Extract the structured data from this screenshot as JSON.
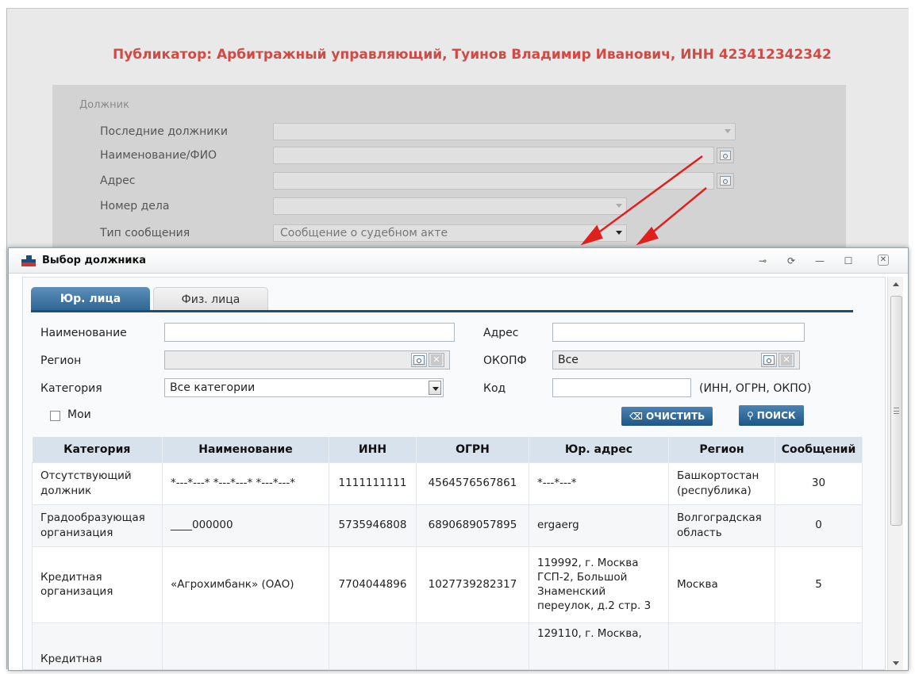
{
  "publisher": "Публикатор: Арбитражный управляющий, Туинов Владимир Иванович, ИНН 423412342342",
  "debtor_form": {
    "legend": "Должник",
    "fields": [
      {
        "label": "Последние должники",
        "value": ""
      },
      {
        "label": "Наименование/ФИО",
        "value": ""
      },
      {
        "label": "Адрес",
        "value": ""
      },
      {
        "label": "Номер дела",
        "value": ""
      },
      {
        "label": "Тип сообщения",
        "value": "Сообщение о судебном акте"
      }
    ]
  },
  "dialog": {
    "title": "Выбор должника",
    "tabs": [
      {
        "label": "Юр. лица",
        "active": true
      },
      {
        "label": "Физ. лица",
        "active": false
      }
    ],
    "filters": {
      "name_label": "Наименование",
      "name_value": "",
      "region_label": "Регион",
      "region_value": "",
      "category_label": "Категория",
      "category_value": "Все категории",
      "mine_label": "Мои",
      "address_label": "Адрес",
      "address_value": "",
      "okopf_label": "ОКОПФ",
      "okopf_value": "Все",
      "code_label": "Код",
      "code_value": "",
      "code_hint": "(ИНН, ОГРН, ОКПО)",
      "clear_label": "ОЧИСТИТЬ",
      "search_label": "ПОИСК"
    },
    "table": {
      "columns": [
        "Категория",
        "Наименование",
        "ИНН",
        "ОГРН",
        "Юр. адрес",
        "Регион",
        "Сообщений"
      ],
      "rows": [
        {
          "category": "Отсутствующий должник",
          "name": "*---*---* *---*---* *---*---*",
          "inn": "1111111111",
          "ogrn": "4564576567861",
          "address": "*---*---*",
          "region": "Башкортостан (республика)",
          "messages": "30"
        },
        {
          "category": "Градообразующая организация",
          "name": "____000000",
          "inn": "5735946808",
          "ogrn": "6890689057895",
          "address": "ergaerg",
          "region": "Волгоградская область",
          "messages": "0"
        },
        {
          "category": "Кредитная организация",
          "name": "«Агрохимбанк» (ОАО)",
          "inn": "7704044896",
          "ogrn": "1027739282317",
          "address": "119992, г. Москва ГСП-2, Большой Знаменский переулок, д.2 стр. 3",
          "region": "Москва",
          "messages": "5"
        },
        {
          "category": "Кредитная",
          "name": "",
          "inn": "",
          "ogrn": "",
          "address": "129110, г. Москва,",
          "region": "",
          "messages": ""
        }
      ]
    }
  },
  "colors": {
    "publisher_red": "#d24a44",
    "tab_active": "#2e6593",
    "button_blue": "#1e5686",
    "arrow_red": "#e0201c"
  }
}
